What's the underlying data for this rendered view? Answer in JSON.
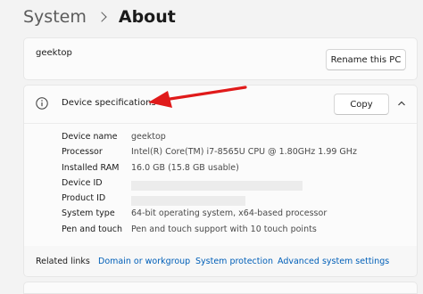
{
  "breadcrumb": {
    "parent": "System",
    "current": "About"
  },
  "pc_card": {
    "pc_name": "geektop",
    "rename_button": "Rename this PC"
  },
  "specs": {
    "title": "Device specifications",
    "copy_button": "Copy",
    "rows": [
      {
        "label": "Device name",
        "value": "geektop"
      },
      {
        "label": "Processor",
        "value": "Intel(R) Core(TM) i7-8565U CPU @ 1.80GHz   1.99 GHz"
      },
      {
        "label": "Installed RAM",
        "value": "16.0 GB (15.8 GB usable)"
      },
      {
        "label": "Device ID",
        "value": ""
      },
      {
        "label": "Product ID",
        "value": ""
      },
      {
        "label": "System type",
        "value": "64-bit operating system, x64-based processor"
      },
      {
        "label": "Pen and touch",
        "value": "Pen and touch support with 10 touch points"
      }
    ]
  },
  "related": {
    "label": "Related links",
    "links": [
      "Domain or workgroup",
      "System protection",
      "Advanced system settings"
    ]
  },
  "colors": {
    "link": "#005fb8",
    "annotation_arrow": "#e01a1a"
  },
  "icons": {
    "breadcrumb_separator": "chevron-right-icon",
    "specs_info": "info-icon",
    "collapse": "chevron-up-icon"
  }
}
